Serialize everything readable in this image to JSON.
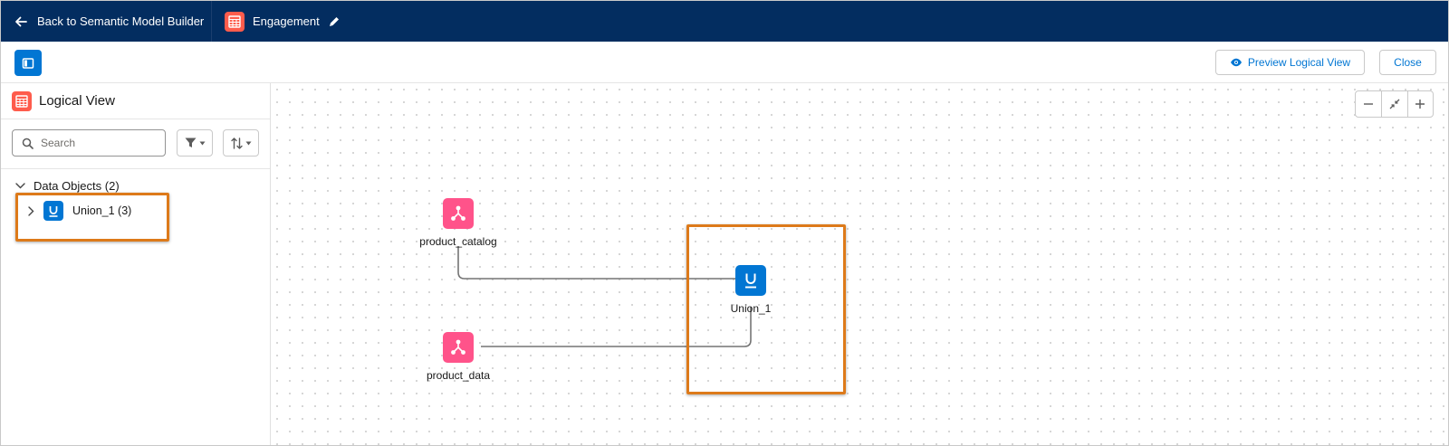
{
  "header": {
    "back_label": "Back to Semantic Model Builder",
    "model_name": "Engagement"
  },
  "toolbar": {
    "preview_label": "Preview Logical View",
    "close_label": "Close"
  },
  "left_panel": {
    "title": "Logical View",
    "search_placeholder": "Search",
    "group_label": "Data Objects (2)",
    "items": [
      {
        "label": "Union_1 (3)",
        "icon": "union-icon"
      }
    ]
  },
  "canvas": {
    "nodes": [
      {
        "label": "product_catalog",
        "icon": "data-object-icon"
      },
      {
        "label": "product_data",
        "icon": "data-object-icon"
      },
      {
        "label": "Union_1",
        "icon": "union-icon"
      }
    ],
    "zoom_controls": [
      "zoom-out",
      "fit-to-view",
      "zoom-in"
    ]
  },
  "colors": {
    "header_bg": "#032d60",
    "brand_blue": "#0176d3",
    "data_object_pink": "#ff538a",
    "model_orange": "#fe5c4c",
    "highlight_orange": "#dd7a1a"
  }
}
